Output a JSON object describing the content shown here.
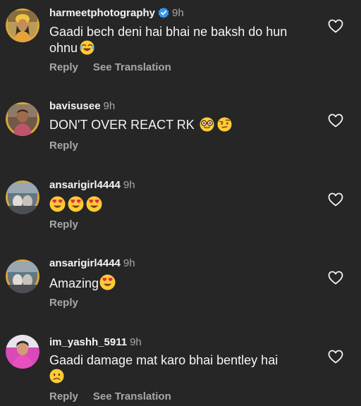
{
  "comments": [
    {
      "username": "harmeetphotography",
      "verified": true,
      "time": "9h",
      "text_line1": "Gaadi bech deni hai bhai ne baksh do hun",
      "text_line2": "ohnu",
      "emojis": [
        "face-with-tears-of-joy"
      ],
      "reply_label": "Reply",
      "translation_label": "See Translation"
    },
    {
      "username": "bavisusee",
      "time": "9h",
      "text": "DON'T OVER REACT RK",
      "emojis": [
        "nerd-face",
        "face-with-raised-eyebrow"
      ],
      "reply_label": "Reply"
    },
    {
      "username": "ansarigirl4444",
      "time": "9h",
      "text": "",
      "emojis": [
        "heart-eyes",
        "heart-eyes",
        "heart-eyes"
      ],
      "reply_label": "Reply"
    },
    {
      "username": "ansarigirl4444",
      "time": "9h",
      "text": "Amazing",
      "emojis": [
        "heart-eyes"
      ],
      "reply_label": "Reply"
    },
    {
      "username": "im_yashh_5911",
      "time": "9h",
      "text": "Gaadi damage mat karo bhai bentley hai",
      "emojis": [
        "slightly-frowning-face"
      ],
      "reply_label": "Reply",
      "translation_label": "See Translation"
    }
  ],
  "colors": {
    "background": "#262626",
    "primary_text": "#f5f5f5",
    "secondary_text": "#a8a8a8",
    "verified_badge": "#3897f0"
  },
  "icons": {
    "like": "heart-outline-icon",
    "verified": "verified-badge-icon"
  }
}
